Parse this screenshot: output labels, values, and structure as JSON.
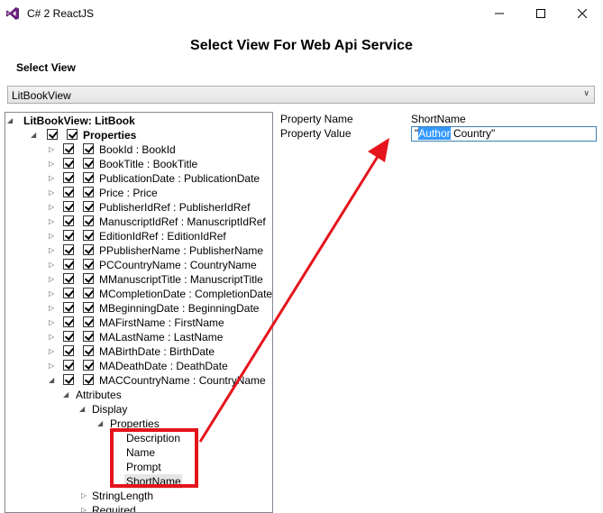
{
  "window": {
    "title": "C# 2 ReactJS",
    "controls": [
      "minimize",
      "maximize",
      "close"
    ]
  },
  "dialog": {
    "heading": "Select View For Web Api Service",
    "select_view_label": "Select View",
    "selected_view": "LitBookView"
  },
  "tree": {
    "root": "LitBookView: LitBook",
    "properties_label": "Properties",
    "items": [
      "BookId : BookId",
      "BookTitle : BookTitle",
      "PublicationDate : PublicationDate",
      "Price : Price",
      "PublisherIdRef : PublisherIdRef",
      "ManuscriptIdRef : ManuscriptIdRef",
      "EditionIdRef : EditionIdRef",
      "PPublisherName : PublisherName",
      "PCCountryName : CountryName",
      "MManuscriptTitle : ManuscriptTitle",
      "MCompletionDate : CompletionDate",
      "MBeginningDate : BeginningDate",
      "MAFirstName : FirstName",
      "MALastName : LastName",
      "MABirthDate : BirthDate",
      "MADeathDate : DeathDate",
      "MACCountryName : CountryName"
    ],
    "attributes_label": "Attributes",
    "display_label": "Display",
    "display_properties_label": "Properties",
    "display_props": [
      "Description",
      "Name",
      "Prompt",
      "ShortName"
    ],
    "string_length_label": "StringLength",
    "required_label": "Required"
  },
  "property_grid": {
    "name_label": "Property Name",
    "name_value": "ShortName",
    "value_label": "Property Value",
    "value_quote_open": "\"",
    "value_selected": "Author",
    "value_rest": " Country\""
  },
  "colors": {
    "annotation_red": "#e5141c",
    "selection_blue": "#3399ff",
    "vs_purple": "#68217a"
  }
}
